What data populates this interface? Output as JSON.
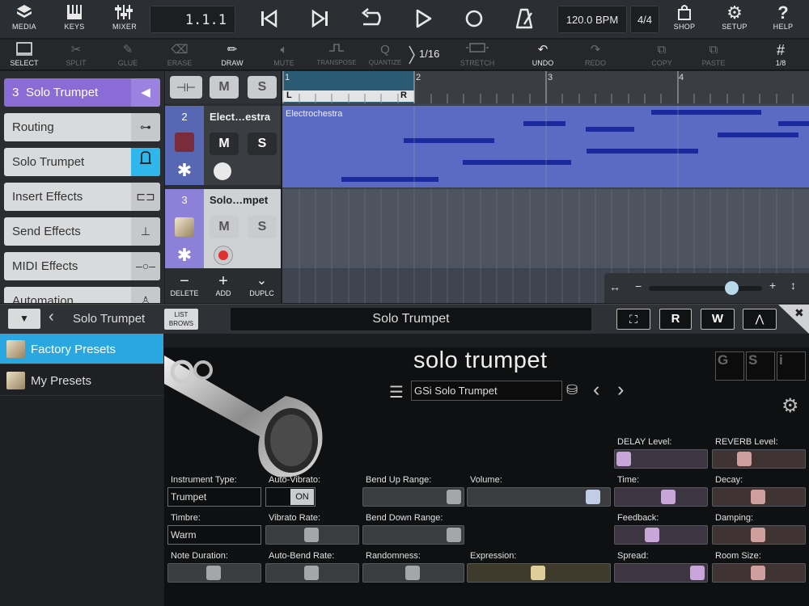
{
  "topbar": {
    "media": "MEDIA",
    "keys": "KEYS",
    "mixer": "MIXER",
    "position": "1.1.1",
    "bpm": "120.0 BPM",
    "signature": "4/4",
    "shop": "SHOP",
    "setup": "SETUP",
    "help": "HELP"
  },
  "tools": {
    "select": "SELECT",
    "split": "SPLIT",
    "glue": "GLUE",
    "erase": "ERASE",
    "draw": "DRAW",
    "mute": "MUTE",
    "transpose": "TRANSPOSE",
    "quantize": "QUANTIZE",
    "quantize_value": "1/16",
    "stretch": "STRETCH",
    "undo": "UNDO",
    "redo": "REDO",
    "copy": "COPY",
    "paste": "PASTE",
    "grid": "1/8"
  },
  "leftpanel": {
    "selected_track_number": "3",
    "selected_track_name": "Solo Trumpet",
    "items": [
      {
        "label": "Routing"
      },
      {
        "label": "Solo Trumpet"
      },
      {
        "label": "Insert Effects"
      },
      {
        "label": "Send Effects"
      },
      {
        "label": "MIDI Effects"
      },
      {
        "label": "Automation"
      }
    ]
  },
  "tracks": {
    "m": "M",
    "s": "S",
    "list": [
      {
        "number": "2",
        "name": "Elect…estra"
      },
      {
        "number": "3",
        "name": "Solo…mpet"
      }
    ],
    "delete": "DELETE",
    "add": "ADD",
    "duplicate": "DUPLC"
  },
  "arrange": {
    "ruler": [
      "1",
      "2",
      "3",
      "4"
    ],
    "loop_left": "L",
    "loop_right": "R",
    "region_name": "Electrochestra"
  },
  "editor": {
    "title": "Solo Trumpet",
    "list_browse_line1": "LIST",
    "list_browse_line2": "BROWS",
    "instrument_name": "Solo Trumpet",
    "btn_r": "R",
    "btn_w": "W"
  },
  "presets": {
    "items": [
      {
        "label": "Factory Presets"
      },
      {
        "label": "My Presets"
      }
    ]
  },
  "instrument": {
    "title": "solo trumpet",
    "preset_name": "GSi Solo Trumpet",
    "tabs": [
      "G",
      "S",
      "i"
    ],
    "instrument_type_label": "Instrument Type:",
    "instrument_type_value": "Trumpet",
    "auto_vibrato_label": "Auto-Vibrato:",
    "auto_vibrato_value": "ON",
    "bend_up_label": "Bend Up Range:",
    "volume_label": "Volume:",
    "timbre_label": "Timbre:",
    "timbre_value": "Warm",
    "vibrato_rate_label": "Vibrato Rate:",
    "bend_down_label": "Bend Down Range:",
    "note_duration_label": "Note Duration:",
    "auto_bend_label": "Auto-Bend Rate:",
    "randomness_label": "Randomness:",
    "expression_label": "Expression:",
    "delay_level_label": "DELAY Level:",
    "reverb_level_label": "REVERB Level:",
    "time_label": "Time:",
    "decay_label": "Decay:",
    "feedback_label": "Feedback:",
    "damping_label": "Damping:",
    "spread_label": "Spread:",
    "room_size_label": "Room Size:"
  }
}
